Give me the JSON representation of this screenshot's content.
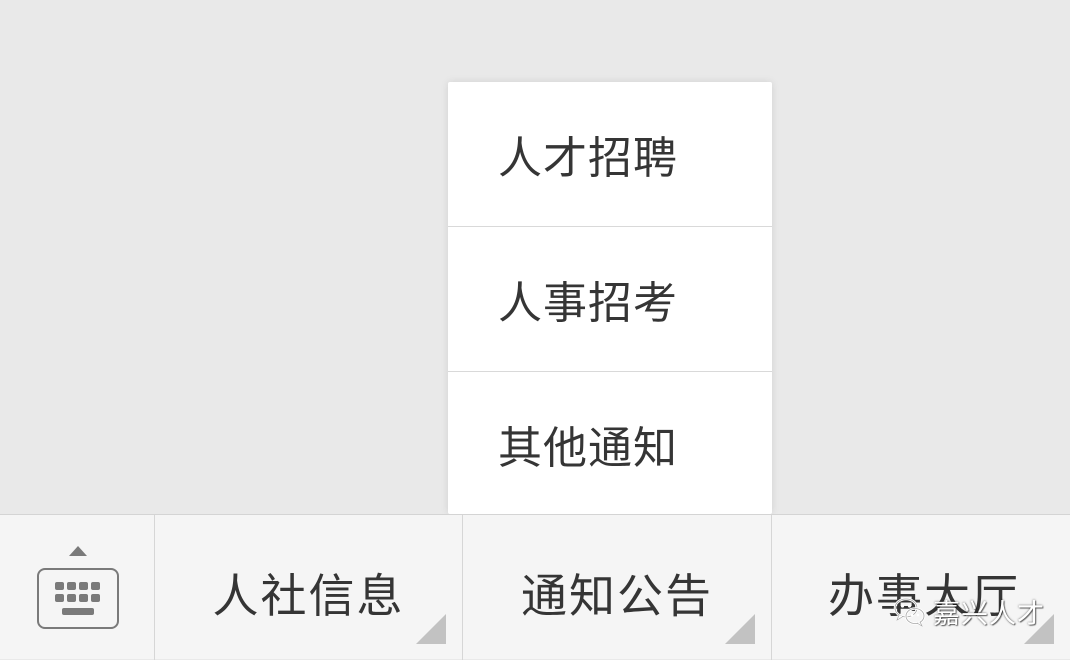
{
  "popup_menu": {
    "items": [
      {
        "label": "人才招聘"
      },
      {
        "label": "人事招考"
      },
      {
        "label": "其他通知"
      }
    ]
  },
  "bottom_bar": {
    "keyboard_icon": "keyboard-icon",
    "tabs": [
      {
        "label": "人社信息"
      },
      {
        "label": "通知公告"
      },
      {
        "label": "办事大厅"
      }
    ]
  },
  "watermark": {
    "icon": "wechat-icon",
    "text": "嘉兴人才"
  },
  "colors": {
    "background": "#e9e9e9",
    "menu_bg": "#ffffff",
    "bar_bg": "#f5f5f5",
    "text": "#353535",
    "icon_gray": "#7a7a7a"
  }
}
